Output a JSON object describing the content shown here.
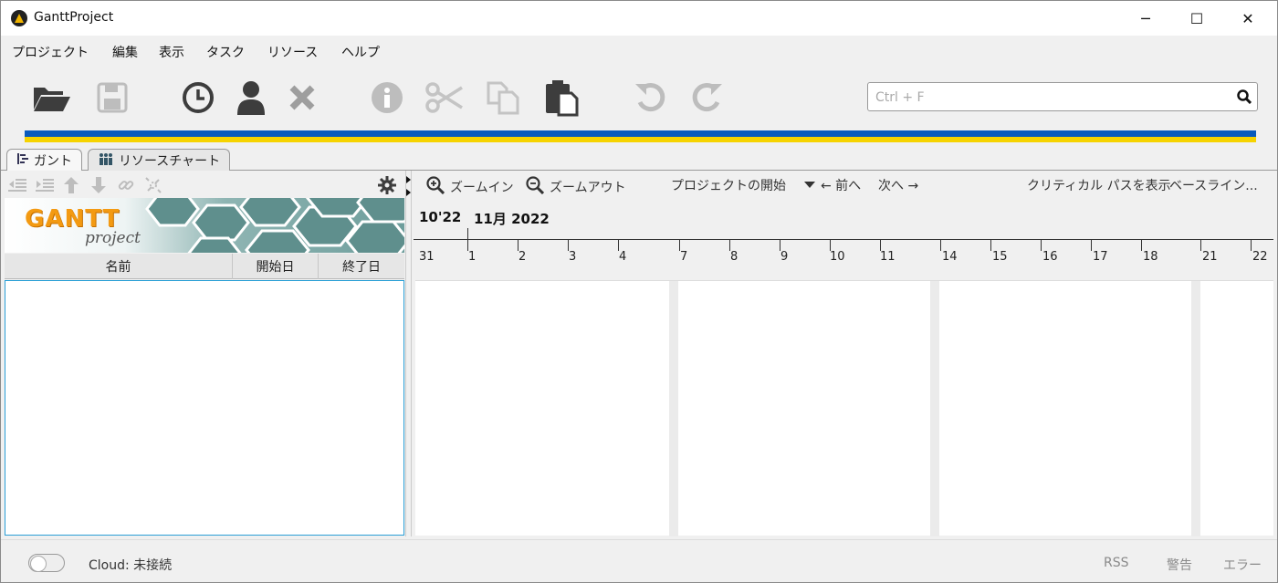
{
  "window": {
    "title": "GanttProject",
    "minimize": "─",
    "maximize": "☐",
    "close": "✕"
  },
  "menu": [
    "プロジェクト",
    "編集",
    "表示",
    "タスク",
    "リソース",
    "ヘルプ"
  ],
  "toolbar": {
    "icons": [
      "folder-open-icon",
      "save-icon",
      "clock-icon",
      "user-icon",
      "delete-icon",
      "info-icon",
      "cut-icon",
      "copy-icon",
      "paste-icon",
      "undo-icon",
      "redo-icon"
    ],
    "search_placeholder": "Ctrl + F",
    "accent_blue": "#0a5bbd",
    "accent_yellow": "#f6d300"
  },
  "tabs": [
    {
      "label": "ガント",
      "active": true
    },
    {
      "label": "リソースチャート",
      "active": false
    }
  ],
  "task_table": {
    "columns": [
      "名前",
      "開始日",
      "終了日"
    ],
    "rows": []
  },
  "banner": {
    "logo": "GANTT project"
  },
  "chart_toolbar": {
    "zoom_in": "ズームイン",
    "zoom_out": "ズームアウト",
    "project_start": "プロジェクトの開始",
    "prev": "← 前へ",
    "next": "次へ →",
    "critical_path": "クリティカル パスを表示",
    "baseline": "ベースライン..."
  },
  "timeline": {
    "month_prev": "10'22",
    "month_current": "11月 2022",
    "days": [
      "31",
      "1",
      "2",
      "3",
      "4",
      "7",
      "8",
      "9",
      "10",
      "11",
      "14",
      "15",
      "16",
      "17",
      "18",
      "21",
      "22"
    ]
  },
  "status": {
    "cloud": "Cloud: 未接続",
    "rss": "RSS",
    "warnings": "警告",
    "errors": "エラー"
  }
}
